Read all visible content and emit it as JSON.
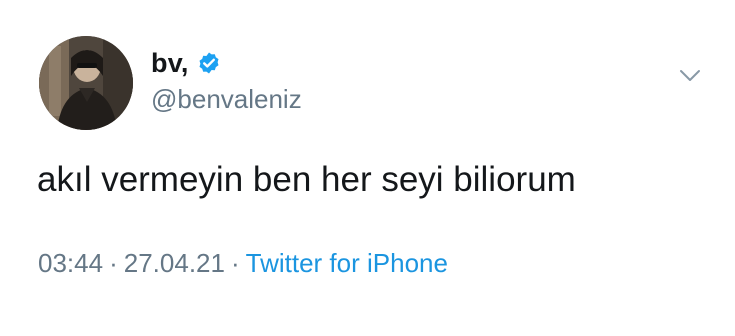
{
  "tweet": {
    "author": {
      "display_name": "bv,",
      "handle": "@benvaleniz",
      "verified": true,
      "avatar_icon": "profile-photo-avatar"
    },
    "text": "akıl vermeyin ben her seyi biliorum",
    "time": "03:44",
    "date": "27.04.21",
    "separator": "·",
    "source": "Twitter for iPhone",
    "menu_icon": "chevron-down-icon"
  },
  "colors": {
    "background": "#ffffff",
    "text_primary": "#14171a",
    "text_secondary": "#657786",
    "accent": "#1b95e0",
    "verified_badge": "#1da1f2"
  }
}
